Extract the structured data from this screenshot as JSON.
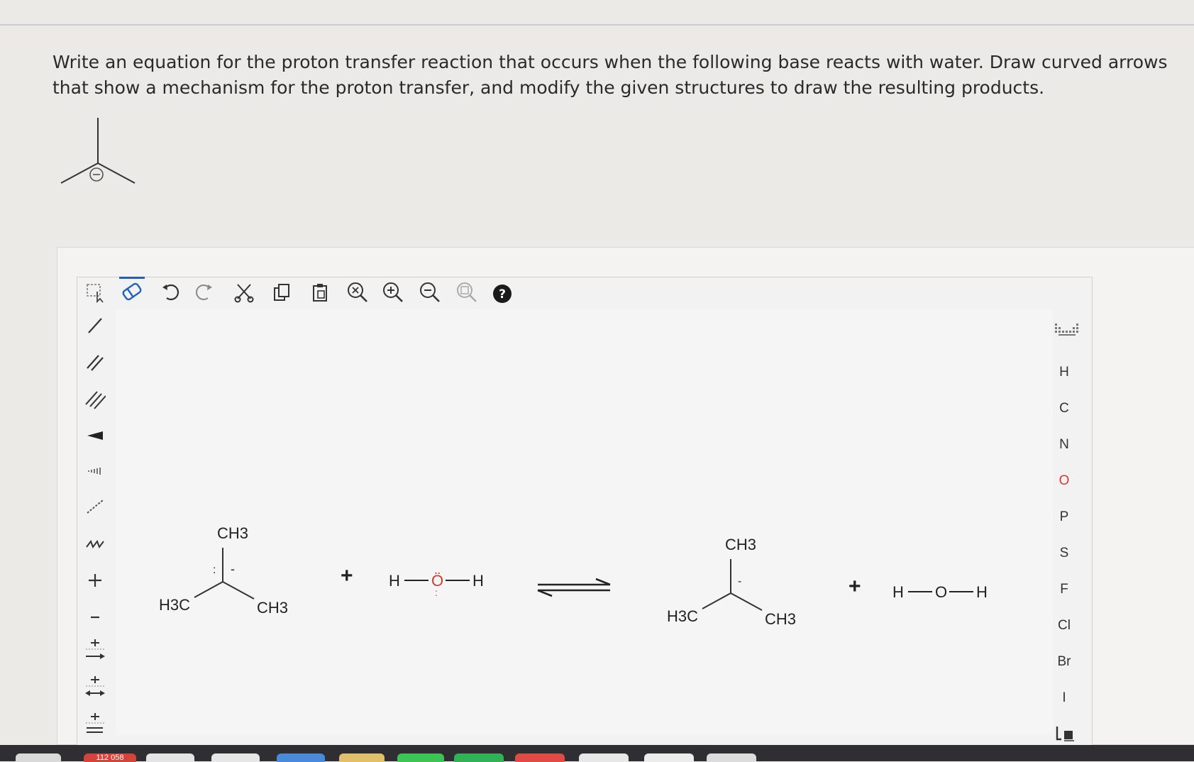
{
  "question": {
    "text": "Write an equation for the proton transfer reaction that occurs when the following base reacts with water. Draw curved arrows that show a mechanism for the proton transfer, and modify the given structures to draw the resulting products."
  },
  "base_molecule": {
    "charge_symbol": "⊖"
  },
  "toolbar": {
    "top_tools": [
      "select-tool",
      "eraser-tool",
      "undo",
      "redo",
      "cut",
      "copy",
      "paste",
      "zoom-reset",
      "zoom-in",
      "zoom-out",
      "zoom-fit",
      "help"
    ],
    "help_label": "?"
  },
  "canvas": {
    "reactant1": {
      "top": "CH3",
      "left": "H3C",
      "right": "CH3",
      "lone_pair": ":",
      "charge": "-"
    },
    "plus1": "+",
    "water1": {
      "left_h": "H",
      "o": "Ö",
      "right_h": "H",
      "lone_below": ":"
    },
    "product1": {
      "top": "CH3",
      "left": "H3C",
      "right": "CH3",
      "charge": "-"
    },
    "plus2": "+",
    "water2": {
      "left_h": "H",
      "o": "O",
      "right_h": "H"
    }
  },
  "left_tools": [
    "select-tool",
    "single-bond",
    "double-bond",
    "triple-bond",
    "wedge-bond",
    "hash-bond",
    "dash-bond",
    "chain-tool",
    "charge-plus",
    "charge-minus",
    "arrow-plus",
    "arrow-double-plus",
    "arrow-equilibrium-plus"
  ],
  "periodic": {
    "elements": [
      "H",
      "C",
      "N",
      "O",
      "P",
      "S",
      "F",
      "Cl",
      "Br",
      "I"
    ]
  },
  "taskbar": {
    "badge": "112 058"
  },
  "colors": {
    "accent": "#1f5fbf",
    "oxygen_red": "#d23b2e"
  }
}
